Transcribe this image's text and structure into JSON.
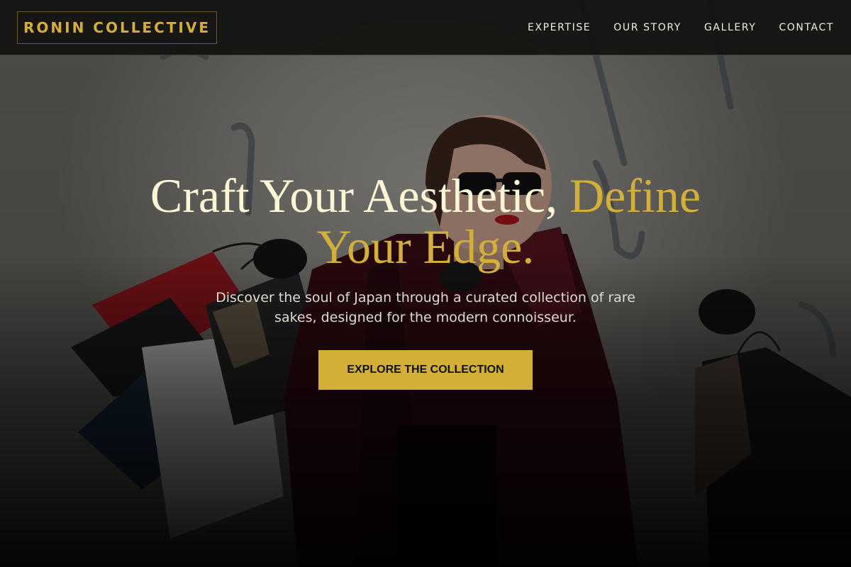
{
  "header": {
    "brand": "RONIN COLLECTIVE",
    "nav": [
      {
        "label": "EXPERTISE"
      },
      {
        "label": "OUR STORY"
      },
      {
        "label": "GALLERY"
      },
      {
        "label": "CONTACT"
      }
    ]
  },
  "hero": {
    "headline_main": "Craft Your Aesthetic, ",
    "headline_accent": "Define Your Edge.",
    "subtitle": "Discover the soul of Japan through a curated collection of rare sakes, designed for the modern connoisseur.",
    "cta_label": "EXPLORE THE COLLECTION",
    "background_image": "woman-with-shopping-bags-photo"
  },
  "colors": {
    "accent_gold": "#d4af37",
    "headline_cream": "#fcf6d6",
    "header_bg": "#141412",
    "nav_text": "#f2efe4"
  }
}
